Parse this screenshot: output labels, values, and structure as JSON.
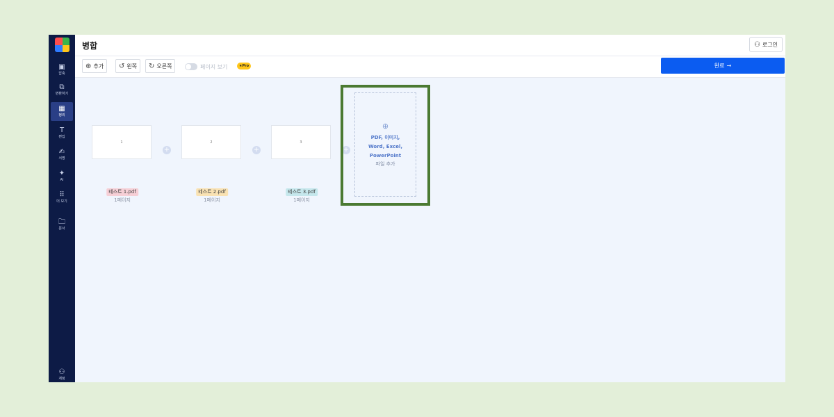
{
  "app": {
    "title": "병합"
  },
  "header": {
    "login_label": "로그인"
  },
  "sidebar": {
    "items": [
      {
        "label": "압축",
        "icon": "compress-icon"
      },
      {
        "label": "변환하기",
        "icon": "convert-icon"
      },
      {
        "label": "정리",
        "icon": "organize-icon",
        "active": true
      },
      {
        "label": "편집",
        "icon": "text-edit-icon"
      },
      {
        "label": "서명",
        "icon": "signature-icon"
      },
      {
        "label": "AI",
        "icon": "ai-sparkle-icon"
      },
      {
        "label": "더 보기",
        "icon": "grid-more-icon"
      },
      {
        "label": "문서",
        "icon": "folder-icon"
      },
      {
        "label": "계정",
        "icon": "user-icon"
      }
    ]
  },
  "toolbar": {
    "add_label": "추가",
    "rotate_left_label": "왼쪽",
    "rotate_right_label": "오른쪽",
    "page_view_label": "페이지 보기",
    "pro_badge": "★Pro",
    "done_label": "완료",
    "done_color": "#0b5cf1"
  },
  "files": [
    {
      "page_number": "1",
      "name": "테스트 1.pdf",
      "pages": "1페이지",
      "tag_color": "#f6cfd6"
    },
    {
      "page_number": "2",
      "name": "테스트 2.pdf",
      "pages": "1페이지",
      "tag_color": "#f9e2b3"
    },
    {
      "page_number": "3",
      "name": "테스트 3.pdf",
      "pages": "1페이지",
      "tag_color": "#c5e7ec"
    }
  ],
  "dropzone": {
    "types": "PDF, 이미지,\nWord, Excel,\nPowerPoint",
    "add_label": "파일 추가"
  },
  "highlight_color": "#4b7a32"
}
